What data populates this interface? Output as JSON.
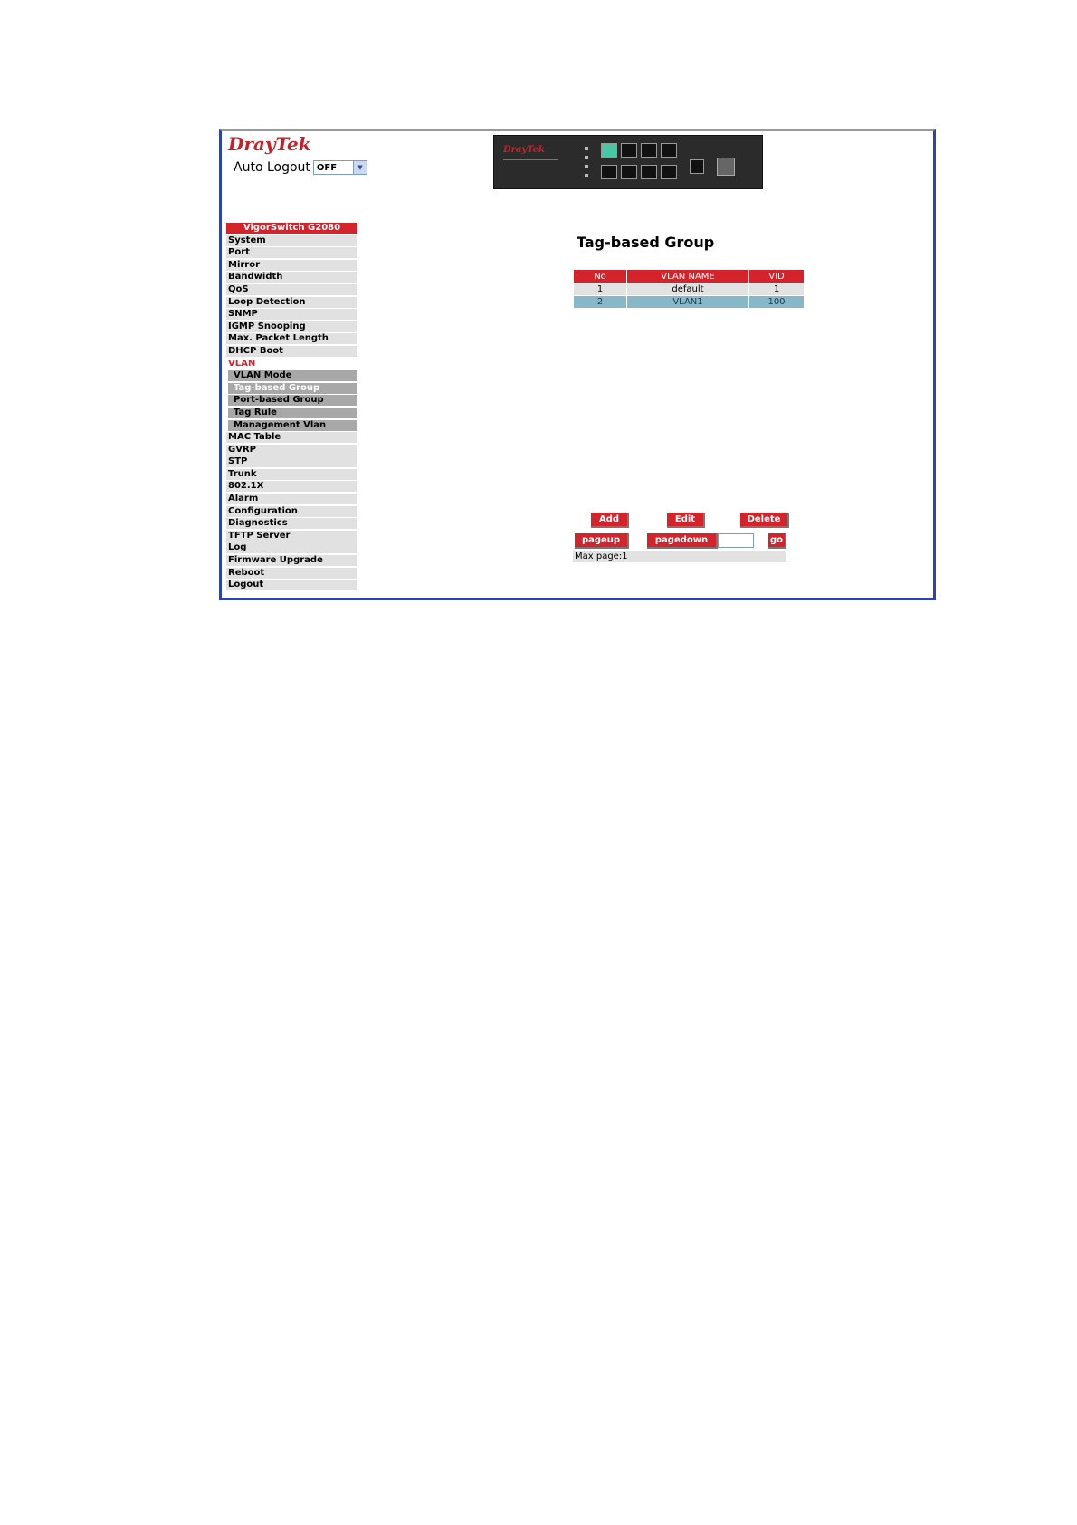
{
  "header": {
    "logo_dray": "Dray",
    "logo_tek": "Tek",
    "auto_logout_label": "Auto Logout",
    "auto_logout_value": "OFF"
  },
  "device": {
    "brand": "DrayTek"
  },
  "menu": {
    "title": "VigorSwitch G2080",
    "items": [
      "System",
      "Port",
      "Mirror",
      "Bandwidth",
      "QoS",
      "Loop Detection",
      "SNMP",
      "IGMP Snooping",
      "Max. Packet Length",
      "DHCP Boot",
      "VLAN"
    ],
    "vlan_sub": [
      "VLAN Mode",
      "Tag-based Group",
      "Port-based Group",
      "Tag Rule",
      "Management Vlan"
    ],
    "items_after": [
      "MAC Table",
      "GVRP",
      "STP",
      "Trunk",
      "802.1X",
      "Alarm",
      "Configuration",
      "Diagnostics",
      "TFTP Server",
      "Log",
      "Firmware Upgrade",
      "Reboot",
      "Logout"
    ]
  },
  "main": {
    "title": "Tag-based Group",
    "table": {
      "headers": [
        "No",
        "VLAN NAME",
        "VID"
      ],
      "rows": [
        [
          "1",
          "default",
          "1"
        ],
        [
          "2",
          "VLAN1",
          "100"
        ]
      ]
    },
    "buttons": {
      "add": "Add",
      "edit": "Edit",
      "delete": "Delete",
      "pageup": "pageup",
      "pagedown": "pagedown",
      "go": "go"
    },
    "page_input_value": "",
    "max_page": "Max page:1"
  }
}
